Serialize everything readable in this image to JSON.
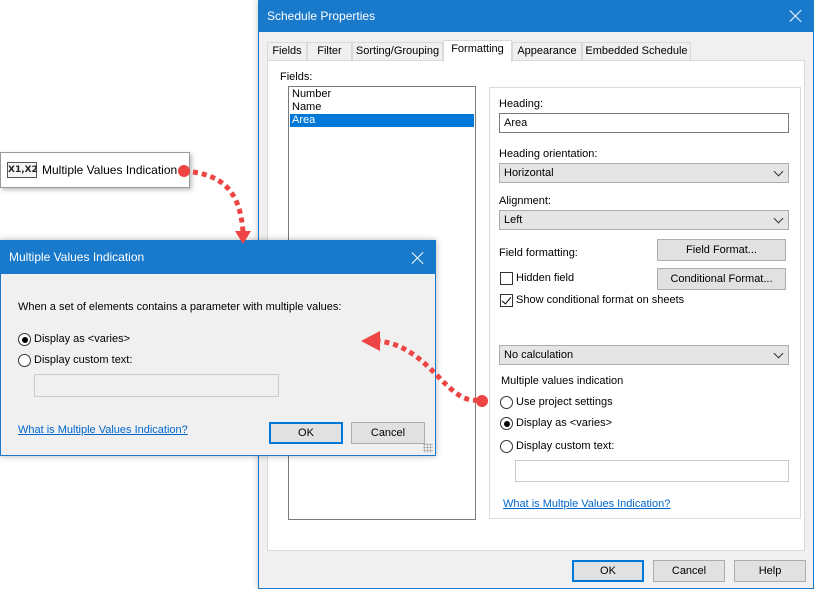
{
  "schedule_properties": {
    "title": "Schedule Properties",
    "tabs": [
      {
        "label": "Fields"
      },
      {
        "label": "Filter"
      },
      {
        "label": "Sorting/Grouping"
      },
      {
        "label": "Formatting",
        "active": true
      },
      {
        "label": "Appearance"
      },
      {
        "label": "Embedded Schedule"
      }
    ],
    "fields_label": "Fields:",
    "fields": [
      "Number",
      "Name",
      "Area"
    ],
    "selected_field": "Area",
    "heading_label": "Heading:",
    "heading_value": "Area",
    "heading_orientation_label": "Heading orientation:",
    "heading_orientation_value": "Horizontal",
    "alignment_label": "Alignment:",
    "alignment_value": "Left",
    "field_formatting_label": "Field formatting:",
    "field_format_button": "Field Format...",
    "hidden_field_label": "Hidden field",
    "hidden_field_checked": false,
    "conditional_format_button": "Conditional  Format...",
    "show_conditional_label": "Show conditional format on sheets",
    "show_conditional_checked": true,
    "calculation_value": "No calculation",
    "mvi_label": "Multiple values indication",
    "mvi_options": [
      "Use project settings",
      "Display as <varies>",
      "Display custom text:"
    ],
    "mvi_selected": "Display as <varies>",
    "custom_text_value": "",
    "help_link": "What is Multple Values Indication?",
    "ok_button": "OK",
    "cancel_button": "Cancel",
    "help_button": "Help"
  },
  "mvi_dialog": {
    "title": "Multiple Values Indication",
    "description": "When a set of elements contains a parameter with multiple values:",
    "options": [
      "Display as <varies>",
      "Display custom text:"
    ],
    "selected": "Display as <varies>",
    "custom_text_value": "",
    "help_link": "What is Multiple Values Indication?",
    "ok_button": "OK",
    "cancel_button": "Cancel"
  },
  "ribbon_button": {
    "icon_text": "X1,X2",
    "icon": "multiple-values-icon",
    "label": "Multiple Values Indication"
  },
  "colors": {
    "titlebar": "#1979ca",
    "selection": "#0078d7",
    "link": "#0066cc",
    "callout_arrow": "#ee4444"
  }
}
